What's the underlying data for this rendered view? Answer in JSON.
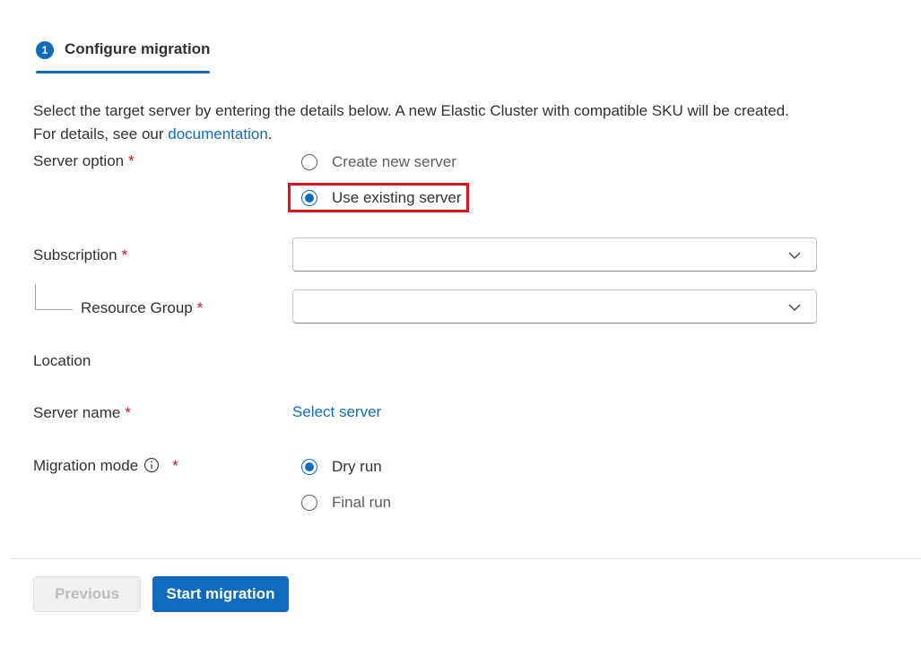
{
  "step": {
    "number": "1",
    "label": "Configure migration"
  },
  "description": {
    "line1": "Select the target server by entering the details below. A new Elastic Cluster with compatible SKU will be created.",
    "line2_prefix": "For details, see our ",
    "link_text": "documentation",
    "line2_suffix": "."
  },
  "server_option": {
    "label": "Server option",
    "required": "*",
    "options": [
      {
        "label": "Create new server",
        "selected": false
      },
      {
        "label": "Use existing server",
        "selected": true
      }
    ]
  },
  "subscription": {
    "label": "Subscription",
    "required": "*",
    "value": ""
  },
  "resource_group": {
    "label": "Resource Group",
    "required": "*",
    "value": ""
  },
  "location": {
    "label": "Location"
  },
  "server_name": {
    "label": "Server name",
    "required": "*",
    "link": "Select server"
  },
  "migration_mode": {
    "label": "Migration mode",
    "required": "*",
    "options": [
      {
        "label": "Dry run",
        "selected": true
      },
      {
        "label": "Final run",
        "selected": false
      }
    ]
  },
  "footer": {
    "previous_label": "Previous",
    "start_label": "Start migration"
  },
  "colors": {
    "accent": "#0f6cbd",
    "required": "#c50f1f",
    "highlight": "#e3111a"
  }
}
